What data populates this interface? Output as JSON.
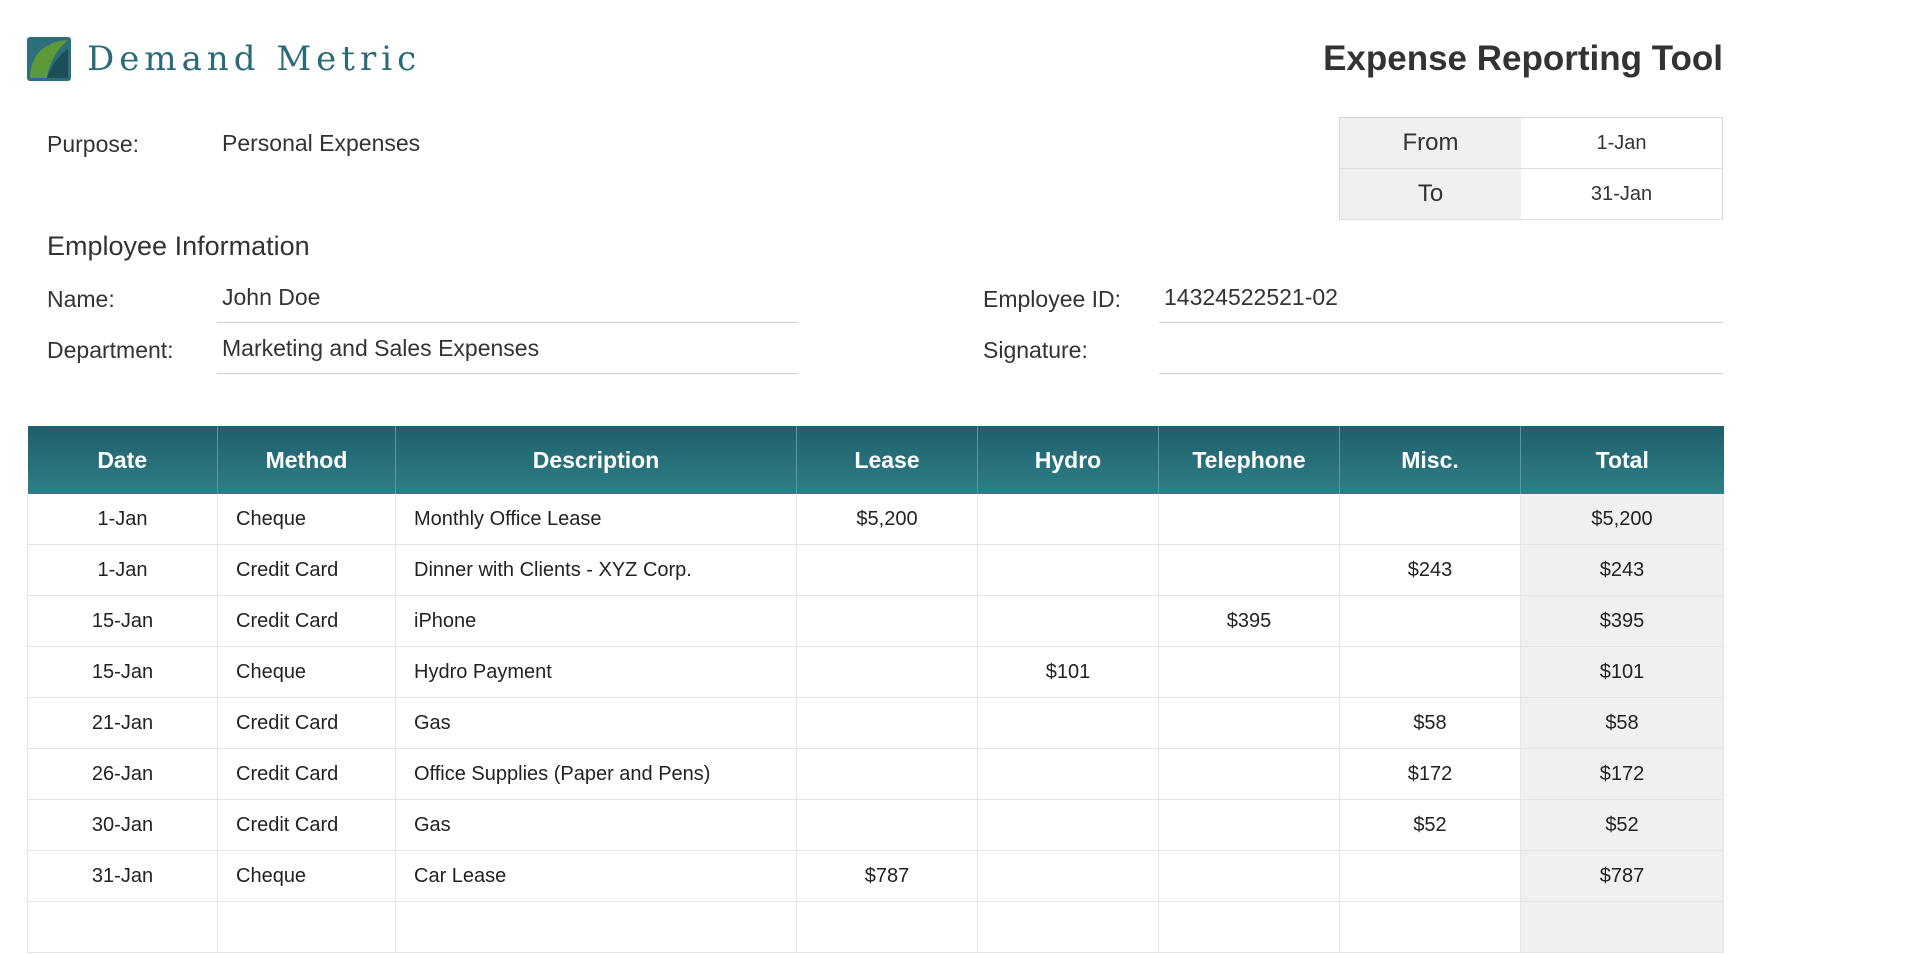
{
  "header": {
    "brand": "Demand Metric",
    "title": "Expense Reporting Tool"
  },
  "purpose": {
    "label": "Purpose:",
    "value": "Personal Expenses"
  },
  "period": {
    "from_label": "From",
    "from_value": "1-Jan",
    "to_label": "To",
    "to_value": "31-Jan"
  },
  "employee": {
    "heading": "Employee Information",
    "name_label": "Name:",
    "name_value": "John Doe",
    "department_label": "Department:",
    "department_value": "Marketing and Sales Expenses",
    "id_label": "Employee ID:",
    "id_value": "14324522521-02",
    "signature_label": "Signature:",
    "signature_value": ""
  },
  "table": {
    "columns": [
      "Date",
      "Method",
      "Description",
      "Lease",
      "Hydro",
      "Telephone",
      "Misc.",
      "Total"
    ],
    "rows": [
      [
        "1-Jan",
        "Cheque",
        "Monthly Office Lease",
        "$5,200",
        "",
        "",
        "",
        "$5,200"
      ],
      [
        "1-Jan",
        "Credit Card",
        "Dinner with Clients - XYZ Corp.",
        "",
        "",
        "",
        "$243",
        "$243"
      ],
      [
        "15-Jan",
        "Credit Card",
        "iPhone",
        "",
        "",
        "$395",
        "",
        "$395"
      ],
      [
        "15-Jan",
        "Cheque",
        "Hydro Payment",
        "",
        "$101",
        "",
        "",
        "$101"
      ],
      [
        "21-Jan",
        "Credit Card",
        "Gas",
        "",
        "",
        "",
        "$58",
        "$58"
      ],
      [
        "26-Jan",
        "Credit Card",
        "Office Supplies (Paper and Pens)",
        "",
        "",
        "",
        "$172",
        "$172"
      ],
      [
        "30-Jan",
        "Credit Card",
        "Gas",
        "",
        "",
        "",
        "$52",
        "$52"
      ],
      [
        "31-Jan",
        "Cheque",
        "Car Lease",
        "$787",
        "",
        "",
        "",
        "$787"
      ],
      [
        "",
        "",
        "",
        "",
        "",
        "",
        "",
        ""
      ]
    ]
  },
  "colors": {
    "brand": "#2b6b78",
    "header_bg": "#1f5f6b",
    "total_bg": "#f0f0f0"
  }
}
